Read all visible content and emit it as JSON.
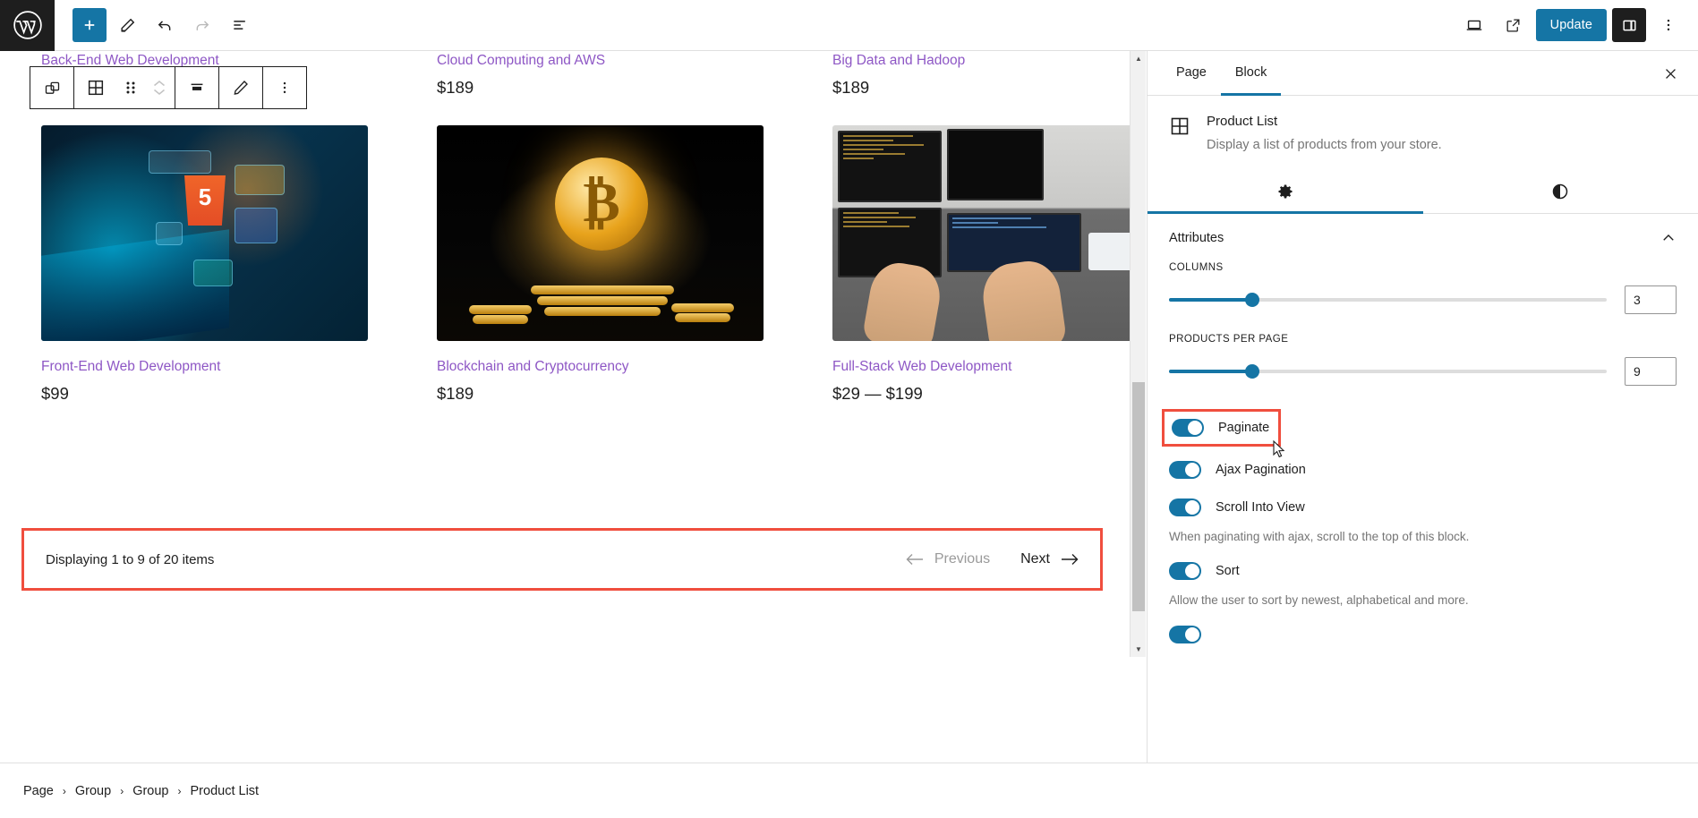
{
  "topbar": {
    "logo_icon": "wordpress-logo-icon",
    "add_block_label": "+",
    "tools": [
      {
        "name": "add-block-button",
        "icon": "plus-icon"
      },
      {
        "name": "edit-tool-button",
        "icon": "pencil-icon"
      },
      {
        "name": "undo-button",
        "icon": "undo-arrow-icon"
      },
      {
        "name": "redo-button",
        "icon": "redo-arrow-icon"
      },
      {
        "name": "document-overview-button",
        "icon": "list-view-icon"
      }
    ],
    "view_icon": "desktop-preview-icon",
    "external_icon": "view-external-link-icon",
    "update_label": "Update",
    "sidebar_toggle_icon": "settings-sidebar-icon",
    "options_icon": "vertical-ellipsis-icon"
  },
  "block_toolbar": {
    "items": [
      {
        "name": "change-block-type-button",
        "icon": "copy-blocks-icon"
      },
      {
        "name": "block-type-product-list-button",
        "icon": "grid-icon"
      },
      {
        "name": "drag-handle",
        "icon": "drag-dots-icon"
      },
      {
        "name": "move-up-down-buttons",
        "icon": "chevron-up-down-icon"
      },
      {
        "name": "align-button",
        "icon": "align-center-icon"
      },
      {
        "name": "edit-button",
        "icon": "pencil-icon"
      },
      {
        "name": "more-options-button",
        "icon": "vertical-ellipsis-icon"
      }
    ]
  },
  "canvas": {
    "row_top": [
      {
        "title": "Back-End Web Development",
        "price": ""
      },
      {
        "title": "Cloud Computing and AWS",
        "price": "$189"
      },
      {
        "title": "Big Data and Hadoop",
        "price": "$189"
      }
    ],
    "row_bottom": [
      {
        "title": "Front-End Web Development",
        "price": "$99",
        "image": "coding-hologram-photo"
      },
      {
        "title": "Blockchain and Cryptocurrency",
        "price": "$189",
        "image": "bitcoin-coin-photo"
      },
      {
        "title": "Full-Stack Web Development",
        "price": "$29 — $199",
        "image": "developer-desk-photo"
      }
    ],
    "pagination": {
      "count_text": "Displaying 1 to 9 of 20 items",
      "previous_label": "Previous",
      "next_label": "Next",
      "prev_icon": "arrow-left-icon",
      "next_icon": "arrow-right-icon"
    }
  },
  "sidebar": {
    "tabs": [
      {
        "label": "Page",
        "active": false
      },
      {
        "label": "Block",
        "active": true
      }
    ],
    "close_icon": "close-x-icon",
    "block": {
      "icon": "grid-icon",
      "title": "Product List",
      "description": "Display a list of products from your store."
    },
    "subtabs": [
      {
        "name": "settings-tab",
        "icon": "gear-icon",
        "active": true
      },
      {
        "name": "styles-tab",
        "icon": "contrast-half-circle-icon",
        "active": false
      }
    ],
    "panel": {
      "title": "Attributes",
      "collapse_icon": "chevron-up-icon",
      "controls": [
        {
          "label": "COLUMNS",
          "value": "3",
          "fill_percent": 19
        },
        {
          "label": "PRODUCTS PER PAGE",
          "value": "9",
          "fill_percent": 19
        }
      ],
      "toggles": [
        {
          "label": "Paginate",
          "on": true,
          "highlighted": true,
          "help": ""
        },
        {
          "label": "Ajax Pagination",
          "on": true,
          "highlighted": false,
          "help": ""
        },
        {
          "label": "Scroll Into View",
          "on": true,
          "highlighted": false,
          "help": "When paginating with ajax, scroll to the top of this block."
        },
        {
          "label": "Sort",
          "on": true,
          "highlighted": false,
          "help": "Allow the user to sort by newest, alphabetical and more."
        }
      ]
    }
  },
  "breadcrumb": {
    "separator": "›",
    "items": [
      "Page",
      "Group",
      "Group",
      "Product List"
    ]
  },
  "colors": {
    "accent": "#1575a5",
    "highlight": "#f04e3e",
    "link": "#8e57c5",
    "muted": "#757575"
  }
}
